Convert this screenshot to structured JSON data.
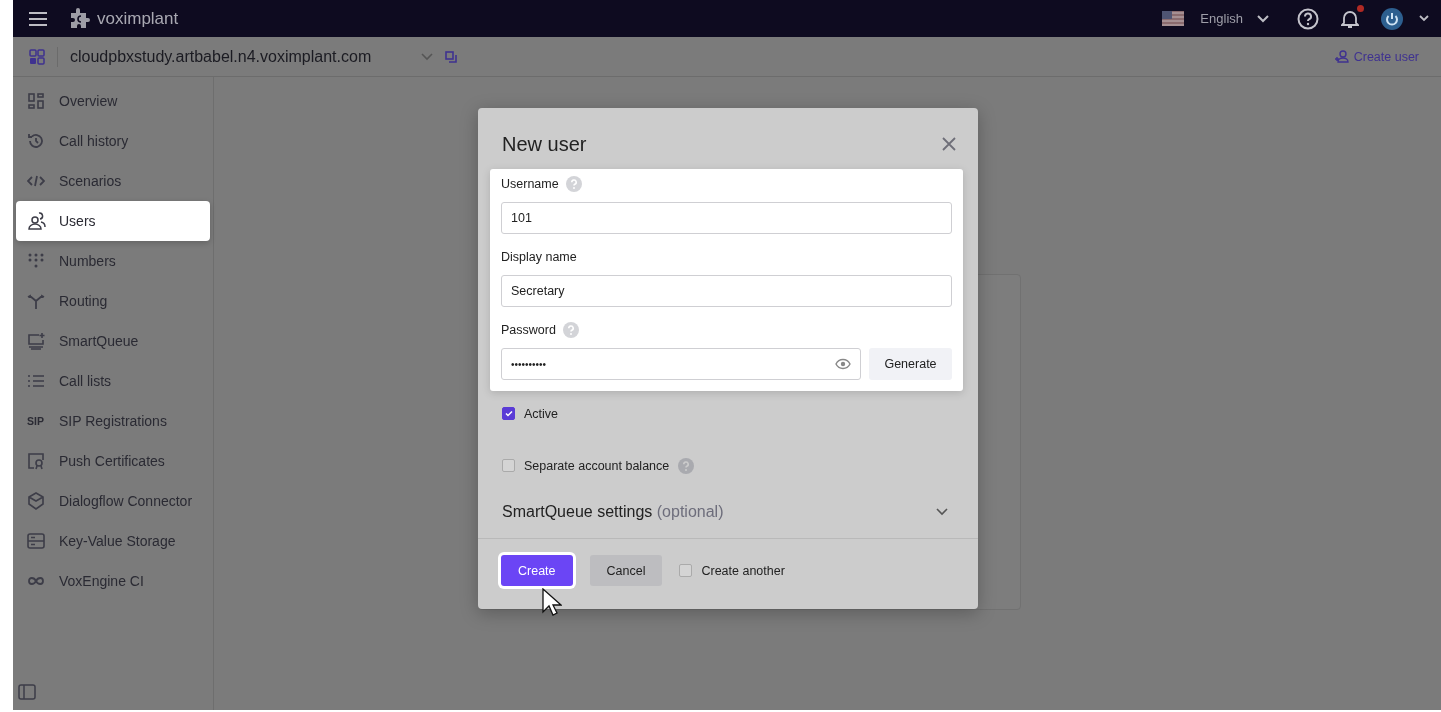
{
  "topbar": {
    "logo": "voximplant",
    "language": "English",
    "notification_unread": true
  },
  "account_bar": {
    "domain": "cloudpbxstudy.artbabel.n4.voximplant.com",
    "create_user": "Create user"
  },
  "sidebar": {
    "items": [
      {
        "label": "Overview",
        "selected": false
      },
      {
        "label": "Call history",
        "selected": false
      },
      {
        "label": "Scenarios",
        "selected": false
      },
      {
        "label": "Users",
        "selected": true
      },
      {
        "label": "Numbers",
        "selected": false
      },
      {
        "label": "Routing",
        "selected": false
      },
      {
        "label": "SmartQueue",
        "selected": false
      },
      {
        "label": "Call lists",
        "selected": false
      },
      {
        "label": "SIP Registrations",
        "selected": false,
        "badge": "SIP"
      },
      {
        "label": "Push Certificates",
        "selected": false
      },
      {
        "label": "Dialogflow Connector",
        "selected": false
      },
      {
        "label": "Key-Value Storage",
        "selected": false
      },
      {
        "label": "VoxEngine CI",
        "selected": false
      }
    ]
  },
  "dialog": {
    "title": "New user",
    "fields": [
      {
        "label": "Username",
        "help": true,
        "value": "101"
      },
      {
        "label": "Display name",
        "help": false,
        "value": "Secretary"
      },
      {
        "label": "Password",
        "help": true,
        "value": "••••••••••",
        "kind": "password",
        "action": "Generate"
      }
    ],
    "checkboxes": [
      {
        "label": "Active",
        "checked": true,
        "help": false
      },
      {
        "label": "Separate account balance",
        "checked": false,
        "help": true
      }
    ],
    "section": {
      "title": "SmartQueue settings",
      "note": "(optional)",
      "expanded": false
    },
    "buttons": [
      {
        "label": "Create",
        "kind": "primary"
      },
      {
        "label": "Cancel",
        "kind": "secondary"
      }
    ],
    "create_another": {
      "label": "Create another",
      "checked": false
    }
  }
}
